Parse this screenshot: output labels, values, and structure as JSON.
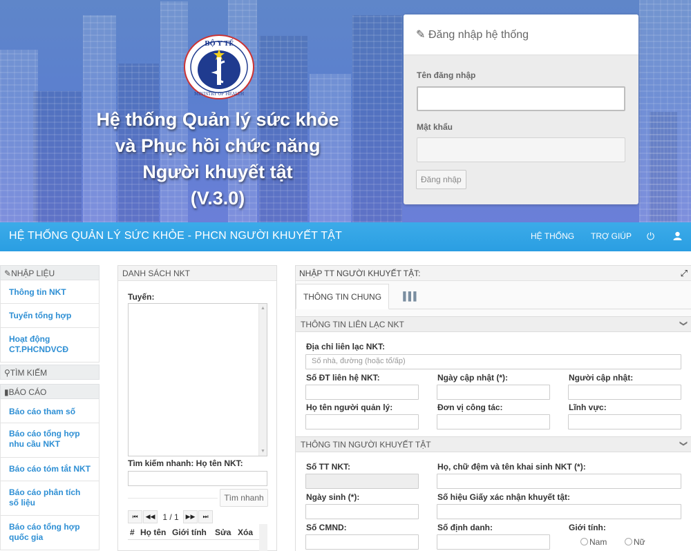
{
  "hero": {
    "logo_text_top": "BỘ Y TẾ",
    "logo_text_bottom": "MINISTRY OF HEALTH",
    "title_lines": [
      "Hệ thống Quản lý sức khỏe",
      "và Phục hồi chức năng",
      "Người khuyết tật",
      "(V.3.0)"
    ]
  },
  "login": {
    "title": "Đăng nhập hệ thống",
    "username_label": "Tên đăng nhập",
    "password_label": "Mật khẩu",
    "submit_label": "Đăng nhập"
  },
  "navbar": {
    "brand": "HỆ THỐNG QUẢN LÝ SỨC KHỎE - PHCN NGƯỜI KHUYẾT TẬT",
    "items": [
      "HỆ THỐNG",
      "TRỢ GIÚP"
    ],
    "icons": [
      "power-icon",
      "user-icon"
    ]
  },
  "sidebar": {
    "sections": [
      {
        "title": "NHẬP LIỆU",
        "icon": "pencil-icon",
        "items": [
          "Thông tin NKT",
          "Tuyến tổng hợp",
          "Hoạt động CT.PHCNDVCĐ"
        ]
      },
      {
        "title": "TÌM KIẾM",
        "icon": "search-icon",
        "items": []
      },
      {
        "title": "BÁO CÁO",
        "icon": "document-icon",
        "items": [
          "Báo cáo tham số",
          "Báo cáo tổng hợp nhu cầu NKT",
          "Báo cáo tóm tắt NKT",
          "Báo cáo phân tích số liệu",
          "Báo cáo tổng hợp quốc gia"
        ]
      }
    ]
  },
  "list_panel": {
    "title": "DANH SÁCH NKT",
    "tuyen_label": "Tuyến:",
    "quick_search_label": "Tìm kiếm nhanh: Họ tên NKT:",
    "quick_search_button": "Tìm nhanh",
    "pager_text": "1 / 1",
    "columns": [
      "#",
      "Họ tên",
      "Giới tính",
      "Sửa",
      "Xóa"
    ]
  },
  "form": {
    "title": "NHẬP TT NGƯỜI KHUYẾT TẬT:",
    "tab_general": "THÔNG TIN CHUNG",
    "contact": {
      "title": "THÔNG TIN LIÊN LẠC NKT",
      "address_label": "Địa chỉ liên lạc NKT:",
      "address_placeholder": "Số nhà, đường (hoặc tổ/ấp)",
      "phone_label": "Số ĐT liên hệ NKT:",
      "updated_date_label": "Ngày cập nhật (*):",
      "updater_label": "Người cập nhật:",
      "manager_name_label": "Họ tên người quản lý:",
      "workplace_label": "Đơn vị công tác:",
      "field_label": "Lĩnh vực:"
    },
    "person": {
      "title": "THÔNG TIN NGƯỜI KHUYẾT TẬT",
      "serial_label": "Số TT NKT:",
      "fullname_label": "Họ, chữ đệm và tên khai sinh NKT (*):",
      "dob_label": "Ngày sinh (*):",
      "certificate_label": "Số hiệu Giấy xác nhận khuyết tật:",
      "id_card_label": "Số CMND:",
      "personal_id_label": "Số định danh:",
      "gender_label": "Giới tính:",
      "gender_options": [
        "Nam",
        "Nữ"
      ]
    }
  }
}
